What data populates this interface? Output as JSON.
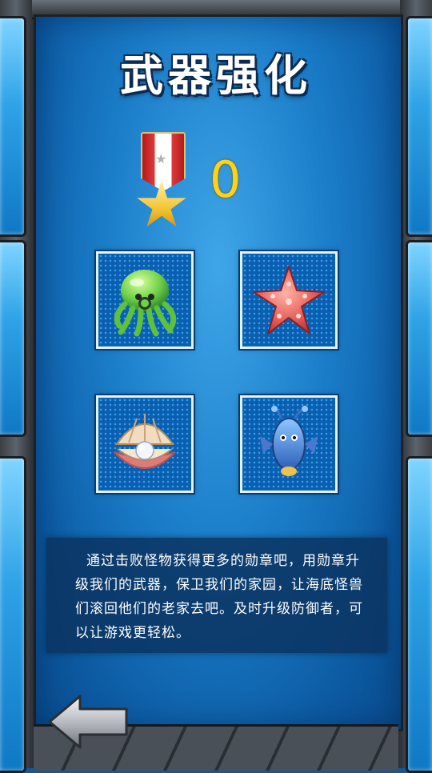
{
  "screen": {
    "title": "武器强化",
    "medal_count": "0",
    "description": "通过击败怪物获得更多的勋章吧，用勋章升级我们的武器，保卫我们的家园，让海底怪兽们滚回他们的老家去吧。及时升级防御者，可以让游戏更轻松。"
  },
  "weapons": [
    {
      "icon": "octopus-icon"
    },
    {
      "icon": "starfish-icon"
    },
    {
      "icon": "clam-pearl-icon"
    },
    {
      "icon": "seahorse-icon"
    }
  ],
  "colors": {
    "panel": "#1a7cc8",
    "medal_count": "#ffd21a",
    "title_text": "#ffffff"
  }
}
